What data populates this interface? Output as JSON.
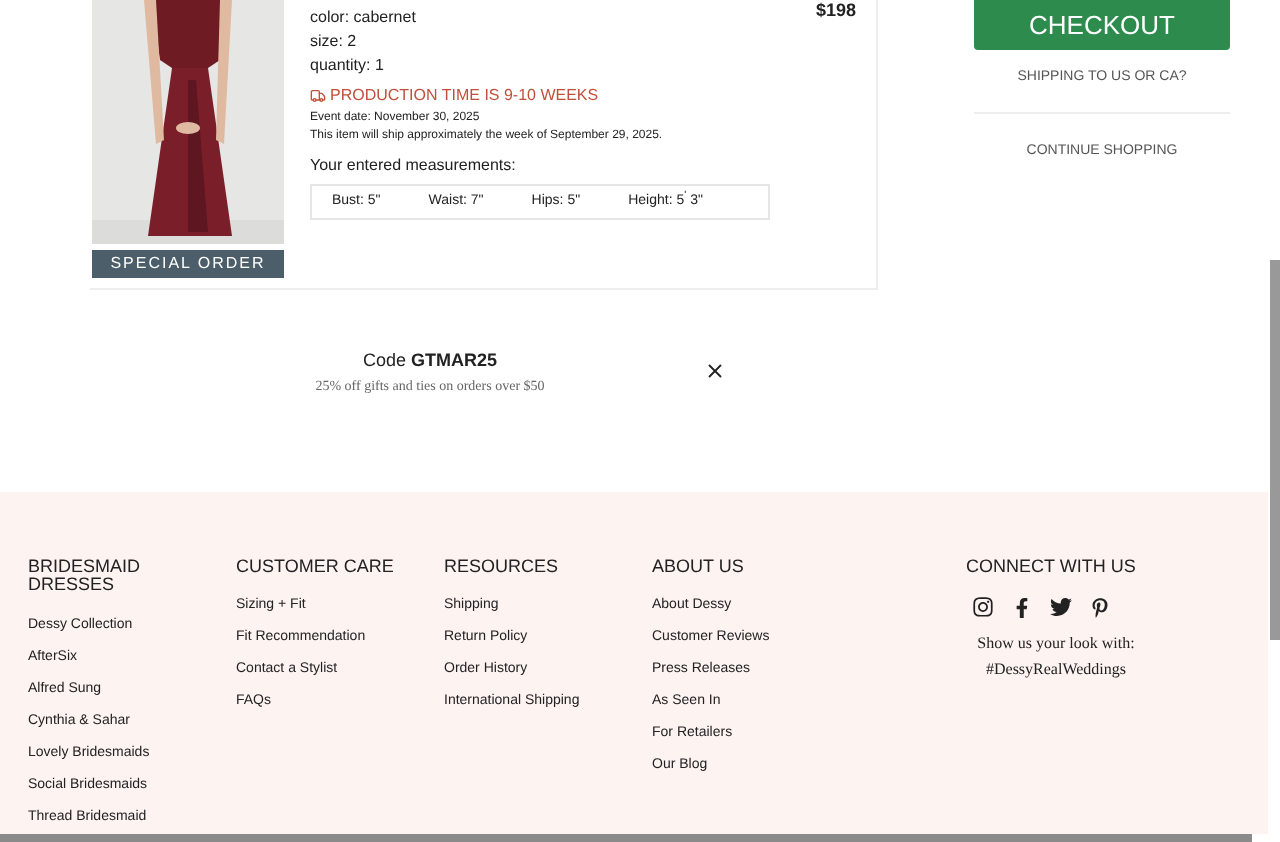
{
  "product": {
    "badge": "SPECIAL ORDER",
    "price": "$198",
    "details": [
      "color: cabernet",
      "size: 2",
      "quantity: 1"
    ],
    "production": "PRODUCTION TIME IS 9-10 WEEKS",
    "event_date": "Event date: November 30, 2025",
    "ship_note": "This item will ship approximately the week of September 29, 2025.",
    "measurements_label": "Your entered measurements:",
    "measurements": [
      "Bust: 5\"",
      "Waist: 7\"",
      "Hips: 5\"",
      "Height: 5$^{'}$ 3\""
    ]
  },
  "checkout": {
    "button": "CHECKOUT",
    "shipping_link": "SHIPPING TO US OR CA?",
    "continue_link": "CONTINUE SHOPPING"
  },
  "promo": {
    "code_label": "Code **GTMAR25**",
    "description": "25% off gifts and ties on orders over $50"
  },
  "footer": {
    "columns": [
      {
        "heading": "BRIDESMAID DRESSES",
        "links": [
          "Dessy Collection",
          "AfterSix",
          "Alfred Sung",
          "Cynthia & Sahar",
          "Lovely Bridesmaids",
          "Social Bridesmaids",
          "Thread Bridesmaid"
        ]
      },
      {
        "heading": "CUSTOMER CARE",
        "links": [
          "Sizing + Fit",
          "Fit Recommendation",
          "Contact a Stylist",
          "FAQs"
        ]
      },
      {
        "heading": "RESOURCES",
        "links": [
          "Shipping",
          "Return Policy",
          "Order History",
          "International Shipping"
        ]
      },
      {
        "heading": "ABOUT US",
        "links": [
          "About Dessy",
          "Customer Reviews",
          "Press Releases",
          "As Seen In",
          "For Retailers",
          "Our Blog"
        ]
      }
    ],
    "connect": {
      "heading": "CONNECT WITH US",
      "tagline": "Show us your look with:",
      "hashtag": "#DessyRealWeddings"
    }
  }
}
